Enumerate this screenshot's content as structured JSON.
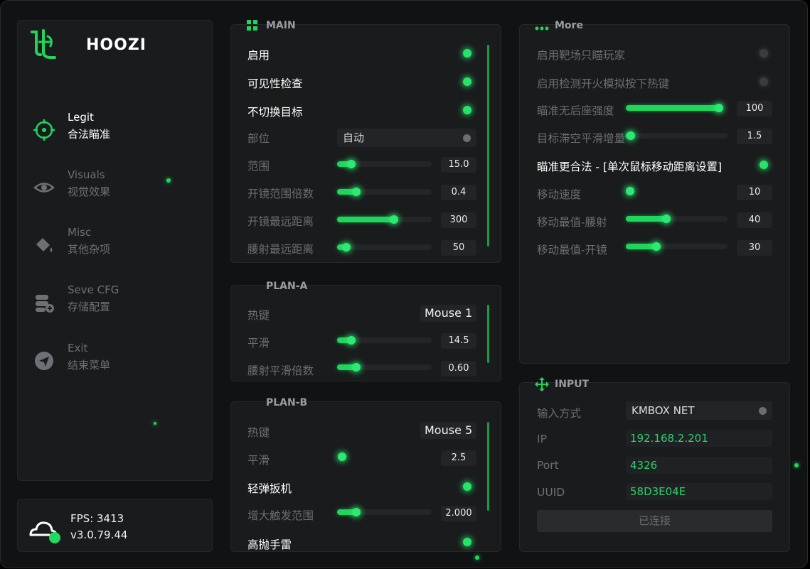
{
  "brand": {
    "name": "HOOZI"
  },
  "nav": [
    {
      "en": "Legit",
      "cn": "合法瞄准",
      "icon": "crosshair-icon",
      "active": true
    },
    {
      "en": "Visuals",
      "cn": "视觉效果",
      "icon": "eye-icon",
      "active": false
    },
    {
      "en": "Misc",
      "cn": "其他杂项",
      "icon": "paint-bucket-icon",
      "active": false
    },
    {
      "en": "Seve CFG",
      "cn": "存储配置",
      "icon": "save-config-icon",
      "active": false
    },
    {
      "en": "Exit",
      "cn": "结束菜单",
      "icon": "send-icon",
      "active": false
    }
  ],
  "status": {
    "fps": "FPS: 3413",
    "version": "v3.0.79.44"
  },
  "main": {
    "title": "MAIN",
    "enable": "启用",
    "visibility_check": "可见性检查",
    "no_switch_target": "不切换目标",
    "bone_label": "部位",
    "bone_value": "自动",
    "fov_label": "范围",
    "fov_value": "15.0",
    "fov_fill": 0.15,
    "scope_fov_label": "开镜范围倍数",
    "scope_fov_value": "0.4",
    "scope_fov_fill": 0.2,
    "scope_dist_label": "开镜最远距离",
    "scope_dist_value": "300",
    "scope_dist_fill": 0.6,
    "hip_dist_label": "腰射最远距离",
    "hip_dist_value": "50",
    "hip_dist_fill": 0.1
  },
  "plan_a": {
    "title": "PLAN-A",
    "hotkey_label": "热键",
    "hotkey_value": "Mouse 1",
    "smooth_label": "平滑",
    "smooth_value": "14.5",
    "smooth_fill": 0.15,
    "hip_smooth_label": "腰射平滑倍数",
    "hip_smooth_value": "0.60",
    "hip_smooth_fill": 0.2
  },
  "plan_b": {
    "title": "PLAN-B",
    "hotkey_label": "热键",
    "hotkey_value": "Mouse 5",
    "smooth_label": "平滑",
    "smooth_value": "2.5",
    "smooth_fill": 0.05,
    "trigger_label": "轻弹扳机",
    "trigger_range_label": "增大触发范围",
    "trigger_range_value": "2.000",
    "trigger_range_fill": 0.2,
    "grenade_label": "高抛手雷"
  },
  "more": {
    "title": "More",
    "range_only_label": "启用靶场只瞄玩家",
    "fire_sim_label": "启用检测开火模拟按下热键",
    "recoil_label": "瞄准无后座强度",
    "recoil_value": "100",
    "recoil_fill": 1.0,
    "air_smooth_label": "目标滞空平滑增量",
    "air_smooth_value": "1.5",
    "air_smooth_fill": 0.05,
    "legit_move_label": "瞄准更合法 - [单次鼠标移动距离设置]",
    "move_speed_label": "移动速度",
    "move_speed_value": "10",
    "move_speed_fill": 0.03,
    "move_hip_label": "移动最值-腰射",
    "move_hip_value": "40",
    "move_hip_fill": 0.4,
    "move_scope_label": "移动最值-开镜",
    "move_scope_value": "30",
    "move_scope_fill": 0.3
  },
  "input": {
    "title": "INPUT",
    "method_label": "输入方式",
    "method_value": "KMBOX NET",
    "ip_label": "IP",
    "ip_value": "192.168.2.201",
    "port_label": "Port",
    "port_value": "4326",
    "uuid_label": "UUID",
    "uuid_value": "58D3E04E",
    "connect_label": "已连接"
  },
  "colors": {
    "accent": "#1ed65c",
    "bg": "#111214",
    "panel": "#1a1b1d"
  }
}
